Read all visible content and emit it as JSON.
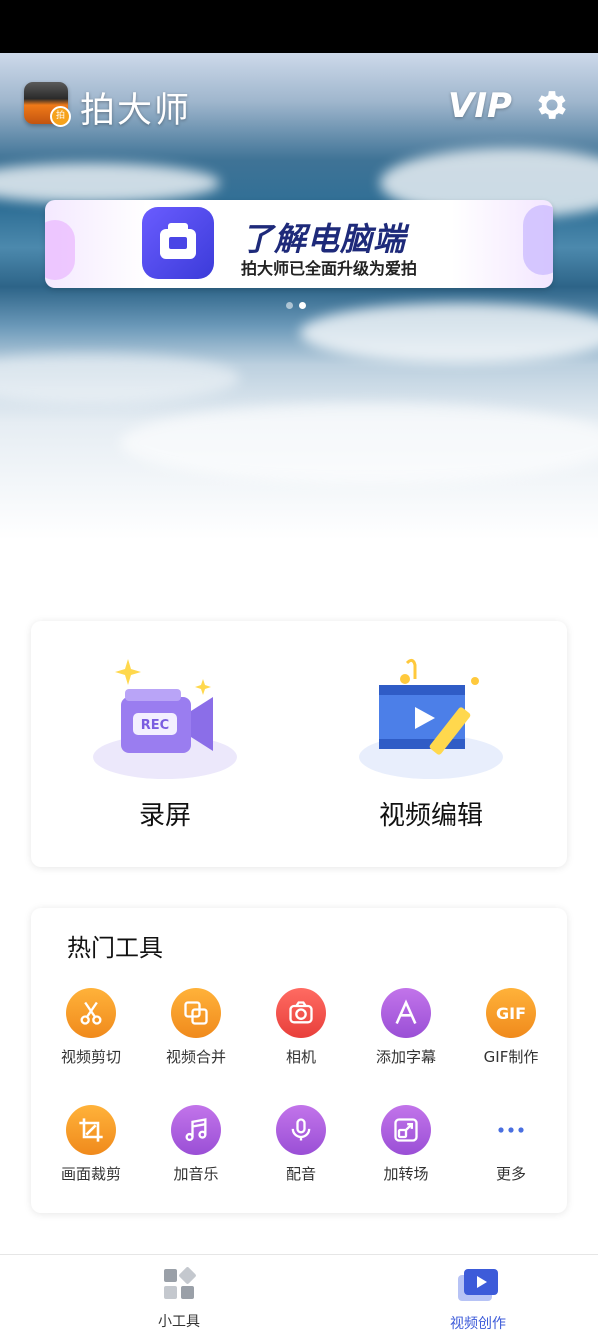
{
  "app": {
    "title": "拍大师",
    "vip_label": "VIP",
    "logo_badge": "拍"
  },
  "banner": {
    "title": "了解电脑端",
    "subtitle": "拍大师已全面升级为爱拍",
    "dots_count": 2,
    "active_dot": 1
  },
  "features": [
    {
      "label": "录屏",
      "icon": "rec-camera-icon"
    },
    {
      "label": "视频编辑",
      "icon": "film-edit-icon"
    }
  ],
  "hot_tools": {
    "title": "热门工具",
    "items": [
      {
        "label": "视频剪切",
        "icon": "scissors-icon",
        "color": "#f59a22"
      },
      {
        "label": "视频合并",
        "icon": "merge-icon",
        "color": "#f59a22"
      },
      {
        "label": "相机",
        "icon": "camera-icon",
        "color": "#ee4c44"
      },
      {
        "label": "添加字幕",
        "icon": "letter-a-icon",
        "color": "#a85edd"
      },
      {
        "label": "GIF制作",
        "icon": "gif-icon",
        "color": "#f59a22",
        "icon_text": "GIF"
      },
      {
        "label": "画面裁剪",
        "icon": "crop-icon",
        "color": "#f59a22"
      },
      {
        "label": "加音乐",
        "icon": "music-note-icon",
        "color": "#a85edd"
      },
      {
        "label": "配音",
        "icon": "microphone-icon",
        "color": "#a85edd"
      },
      {
        "label": "加转场",
        "icon": "transition-icon",
        "color": "#a85edd"
      },
      {
        "label": "更多",
        "icon": "more-dots-icon",
        "color": "#4a6fe0"
      }
    ]
  },
  "bottom_nav": {
    "items": [
      {
        "label": "小工具",
        "icon": "grid-tools-icon",
        "active": false,
        "color": "#333333"
      },
      {
        "label": "视频创作",
        "icon": "video-play-icon",
        "active": true,
        "color": "#3d5bd9"
      }
    ]
  }
}
